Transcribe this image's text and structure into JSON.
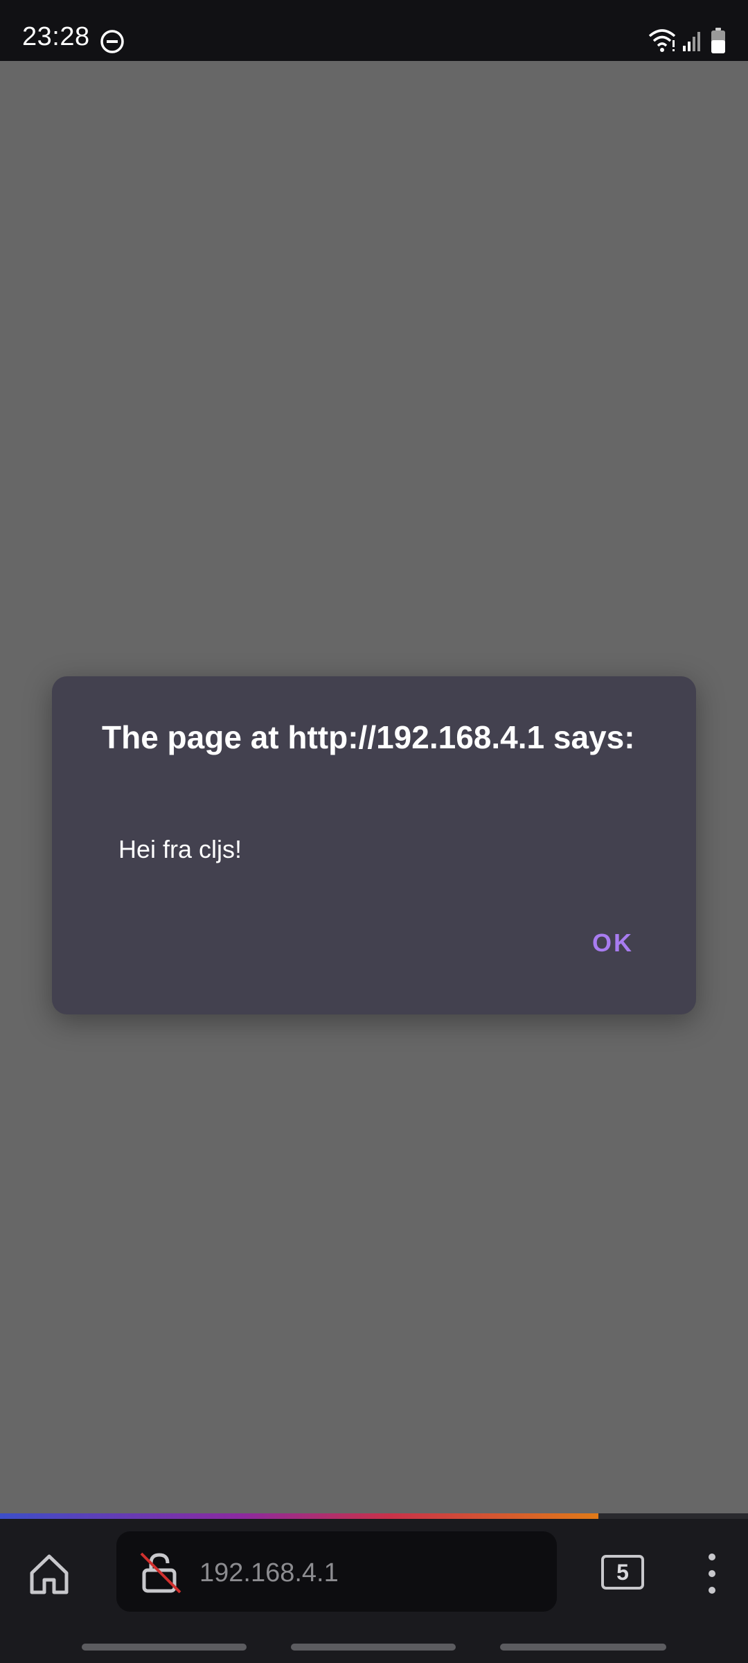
{
  "status_bar": {
    "time": "23:28",
    "icons": [
      "do-not-disturb-icon",
      "wifi-icon",
      "signal-icon",
      "battery-icon"
    ]
  },
  "dialog": {
    "title": "The page at http://192.168.4.1 says:",
    "message": "Hei fra cljs!",
    "ok_label": "OK"
  },
  "toolbar": {
    "url": "192.168.4.1",
    "tab_count": "5",
    "page_load_progress": 0.8
  },
  "colors": {
    "dialog_background": "#43414f",
    "accent": "#a87cf0",
    "scrim": "#676767"
  }
}
